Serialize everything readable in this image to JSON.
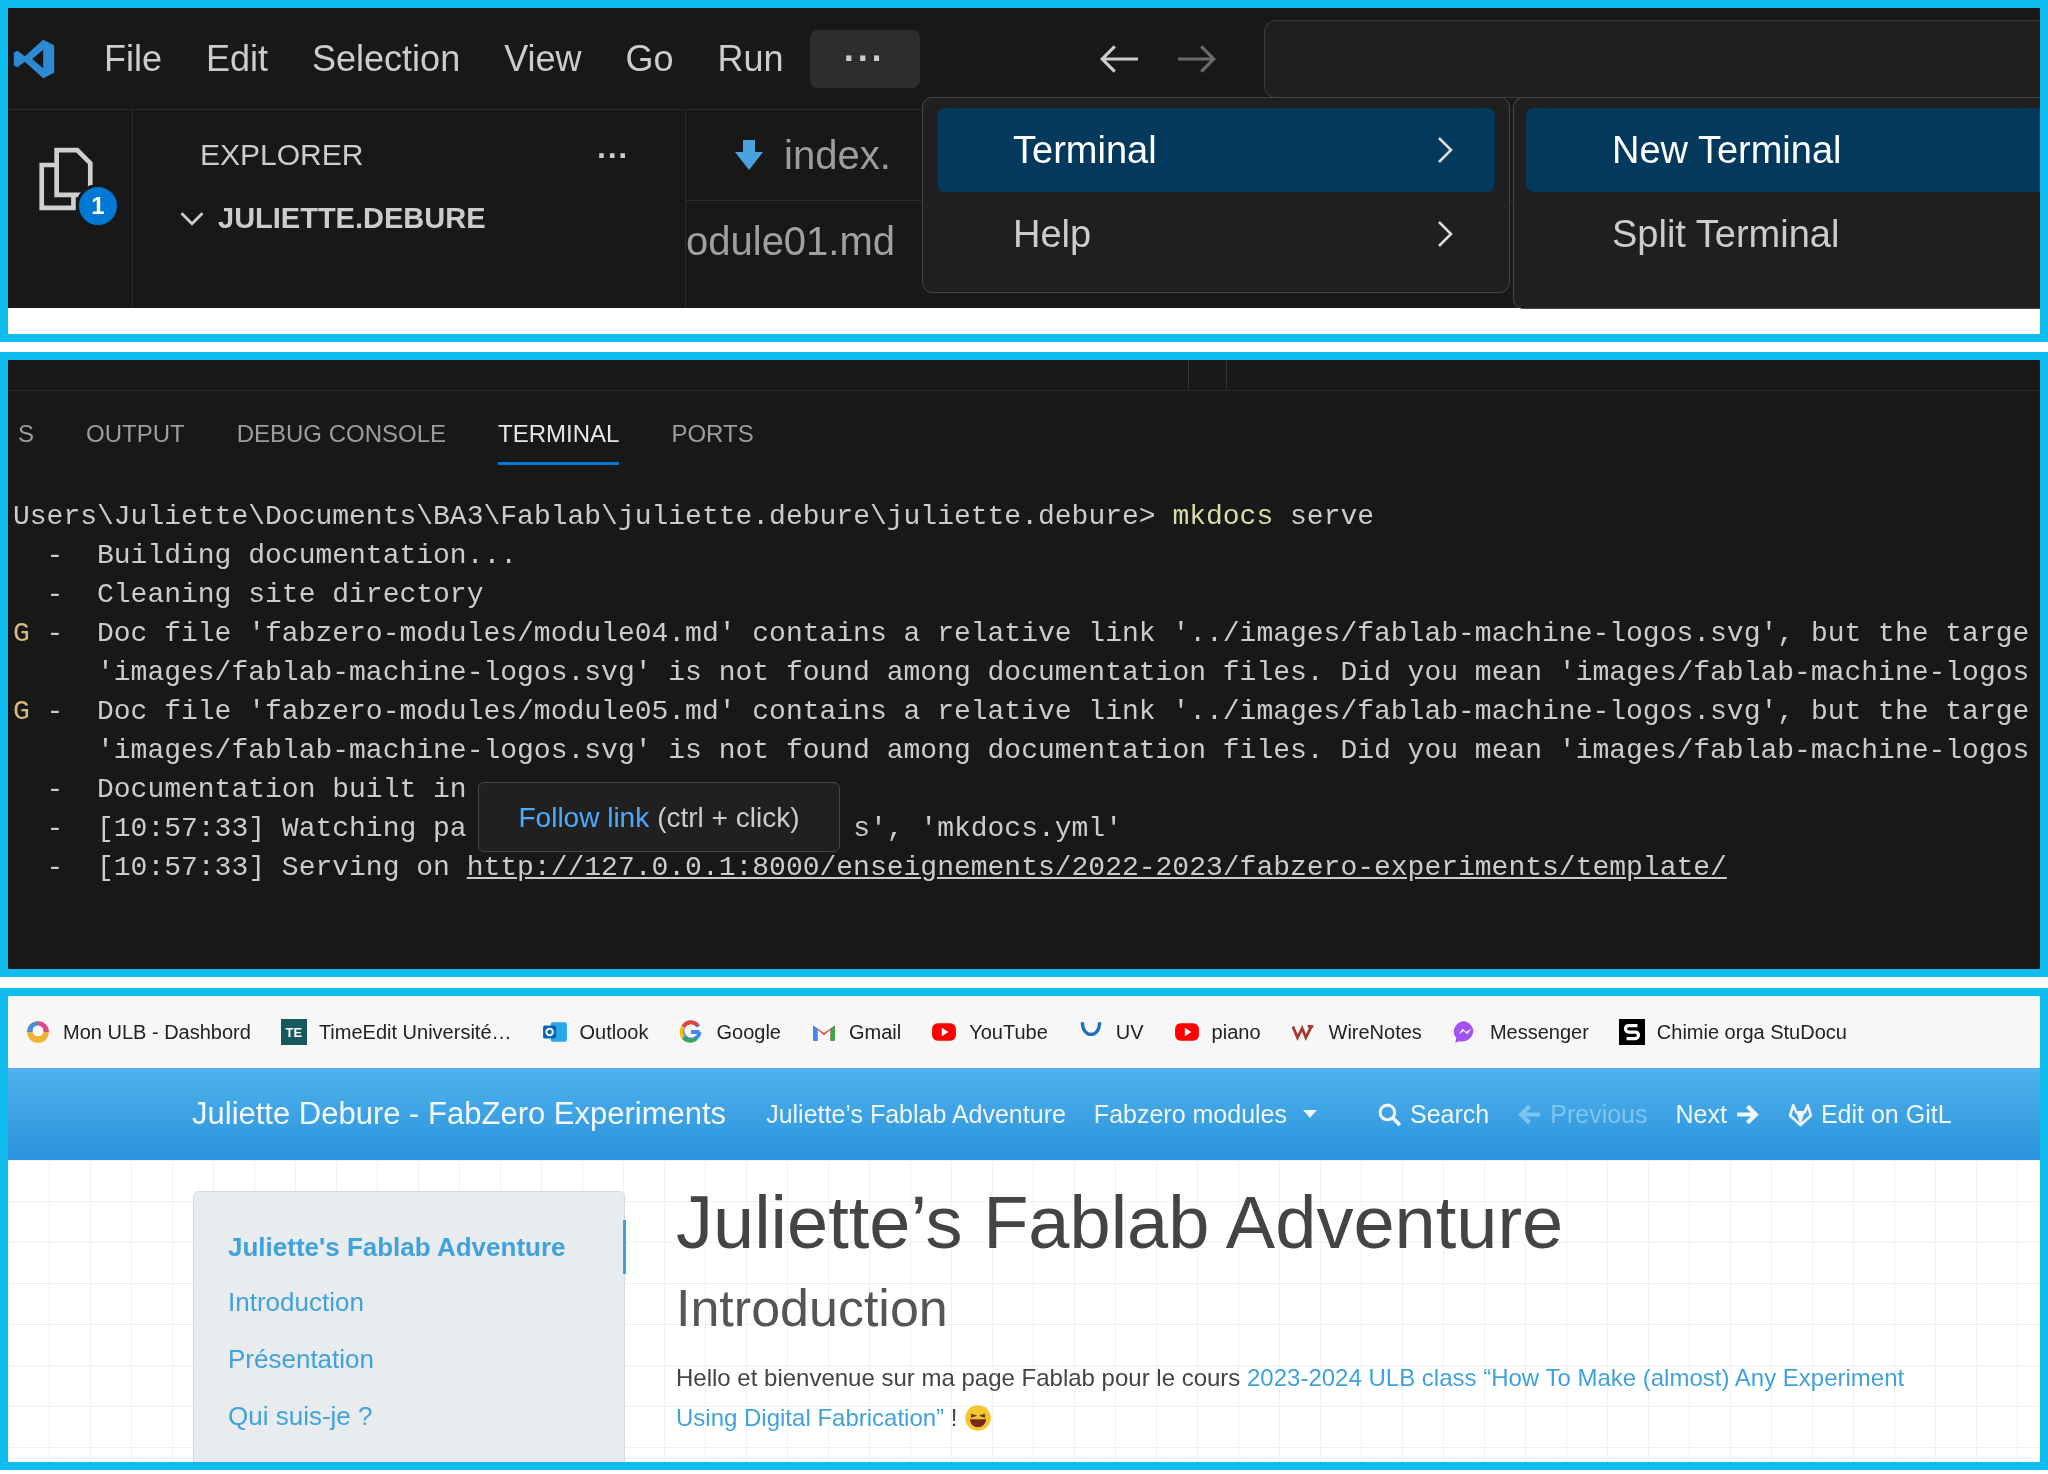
{
  "vscode": {
    "menu_bar": [
      {
        "label": "File",
        "selected": false
      },
      {
        "label": "Edit",
        "selected": false
      },
      {
        "label": "Selection",
        "selected": false
      },
      {
        "label": "View",
        "selected": false
      },
      {
        "label": "Go",
        "selected": false
      },
      {
        "label": "Run",
        "selected": false
      },
      {
        "label": "···",
        "selected": true
      }
    ],
    "nav_buttons": [
      {
        "kind": "back",
        "disabled": false
      },
      {
        "kind": "forward",
        "disabled": true
      }
    ],
    "activity_badge": "1",
    "explorer": {
      "title": "EXPLORER",
      "more": "···",
      "folder": {
        "name": "JULIETTE.DEBURE",
        "expanded": true
      }
    },
    "editor": {
      "tab_label": "index.",
      "breadcrumb": "odule01.md"
    },
    "menu": [
      {
        "label": "Terminal",
        "selected": true
      },
      {
        "label": "Help",
        "selected": false
      }
    ],
    "submenu": [
      {
        "label": "New Terminal",
        "selected": true
      },
      {
        "label": "Split Terminal",
        "selected": false
      }
    ]
  },
  "panel": {
    "tabs": [
      {
        "label": "S",
        "selected": false
      },
      {
        "label": "OUTPUT",
        "selected": false
      },
      {
        "label": "DEBUG CONSOLE",
        "selected": false
      },
      {
        "label": "TERMINAL",
        "selected": true
      },
      {
        "label": "PORTS",
        "selected": false
      }
    ],
    "lines": [
      {
        "kind": "prompt",
        "path": "Users\\Juliette\\Documents\\BA3\\Fablab\\juliette.debure\\juliette.debure>",
        "command": "mkdocs",
        "args": "serve"
      },
      {
        "kind": "info",
        "marker": "-",
        "text": "Building documentation..."
      },
      {
        "kind": "info",
        "marker": "-",
        "text": "Cleaning site directory"
      },
      {
        "kind": "warning",
        "tag": "G",
        "marker": "-",
        "text": "Doc file 'fabzero-modules/module04.md' contains a relative link '../images/fablab-machine-logos.svg', but the targe"
      },
      {
        "kind": "continuation",
        "text": "'images/fablab-machine-logos.svg' is not found among documentation files. Did you mean 'images/fablab-machine-logos"
      },
      {
        "kind": "warning",
        "tag": "G",
        "marker": "-",
        "text": "Doc file 'fabzero-modules/module05.md' contains a relative link '../images/fablab-machine-logos.svg', but the targe"
      },
      {
        "kind": "continuation",
        "text": "'images/fablab-machine-logos.svg' is not found among documentation files. Did you mean 'images/fablab-machine-logos"
      },
      {
        "kind": "info",
        "marker": "-",
        "text": "Documentation built in"
      },
      {
        "kind": "split",
        "marker": "-",
        "text": "[10:57:33] Watching pa",
        "text_after": "s', 'mkdocs.yml'"
      },
      {
        "kind": "link",
        "marker": "-",
        "text": "[10:57:33] Serving on",
        "url": "http://127.0.0.1:8000/enseignements/2022-2023/fabzero-experiments/template/"
      }
    ],
    "tooltip": {
      "link": "Follow link",
      "hint": "(ctrl + click)"
    }
  },
  "browser": {
    "bookmarks": [
      {
        "kind": "pin",
        "label": "Mon ULB - Dashbord"
      },
      {
        "kind": "badge",
        "badge": "TE",
        "label": "TimeEdit Université…"
      },
      {
        "kind": "outlook",
        "label": "Outlook"
      },
      {
        "kind": "google",
        "label": "Google"
      },
      {
        "kind": "gmail",
        "label": "Gmail"
      },
      {
        "kind": "youtube",
        "label": "YouTube"
      },
      {
        "kind": "uv",
        "label": "UV"
      },
      {
        "kind": "youtube",
        "label": "piano"
      },
      {
        "kind": "wirenotes",
        "label": "WireNotes"
      },
      {
        "kind": "messenger",
        "label": "Messenger"
      },
      {
        "kind": "studocu",
        "label": "Chimie orga StuDocu"
      }
    ],
    "navbar": {
      "brand": "Juliette Debure - FabZero Experiments",
      "items": [
        {
          "kind": "link",
          "label": "Juliette’s Fablab Adventure",
          "disabled": false
        },
        {
          "kind": "dropdown",
          "label": "Fabzero modules",
          "disabled": false
        },
        {
          "kind": "search",
          "label": "Search",
          "disabled": false
        },
        {
          "kind": "previous",
          "label": "Previous",
          "disabled": true
        },
        {
          "kind": "next",
          "label": "Next",
          "disabled": false
        },
        {
          "kind": "gitlab",
          "label": "Edit on GitL",
          "disabled": false
        }
      ]
    },
    "toc": [
      {
        "label": "Juliette's Fablab Adventure",
        "selected": true
      },
      {
        "label": "Introduction",
        "selected": false
      },
      {
        "label": "Présentation",
        "selected": false
      },
      {
        "label": "Qui suis-je ?",
        "selected": false
      }
    ],
    "title": "Juliette’s Fablab Adventure",
    "subtitle": "Introduction",
    "paragraph": {
      "text_before": "Hello et bienvenue sur ma page Fablab pour le cours",
      "link_lines": [
        "2023-2024 ULB class “How To Make (almost) Any Experiment",
        "Using Digital Fabrication”"
      ],
      "text_after": "!"
    }
  }
}
